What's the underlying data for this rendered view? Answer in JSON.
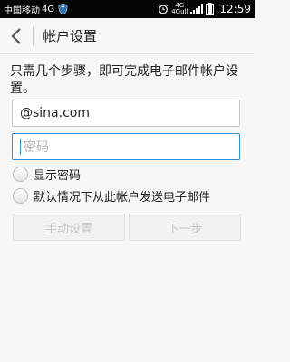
{
  "status_bar": {
    "carrier": "中国移动",
    "network": "4G",
    "network_secondary": "4G",
    "network_tertiary": "4Gull",
    "time": "12:59",
    "icons": [
      "shield-icon",
      "alarm-icon",
      "signal-icon",
      "battery-icon"
    ]
  },
  "app_bar": {
    "title": "帐户设置",
    "back_icon": "chevron-left-icon"
  },
  "intro_text": "只需几个步骤，即可完成电子邮件帐户设置。",
  "form": {
    "email_value": "@sina.com",
    "password_placeholder": "密码",
    "show_password_label": "显示密码",
    "default_send_label": "默认情况下从此帐户发送电子邮件"
  },
  "buttons": {
    "manual_label": "手动设置",
    "next_label": "下一步"
  },
  "colors": {
    "accent": "#2f8fd8",
    "statusbar_bg": "#050505",
    "page_bg": "#f7f7f7"
  }
}
